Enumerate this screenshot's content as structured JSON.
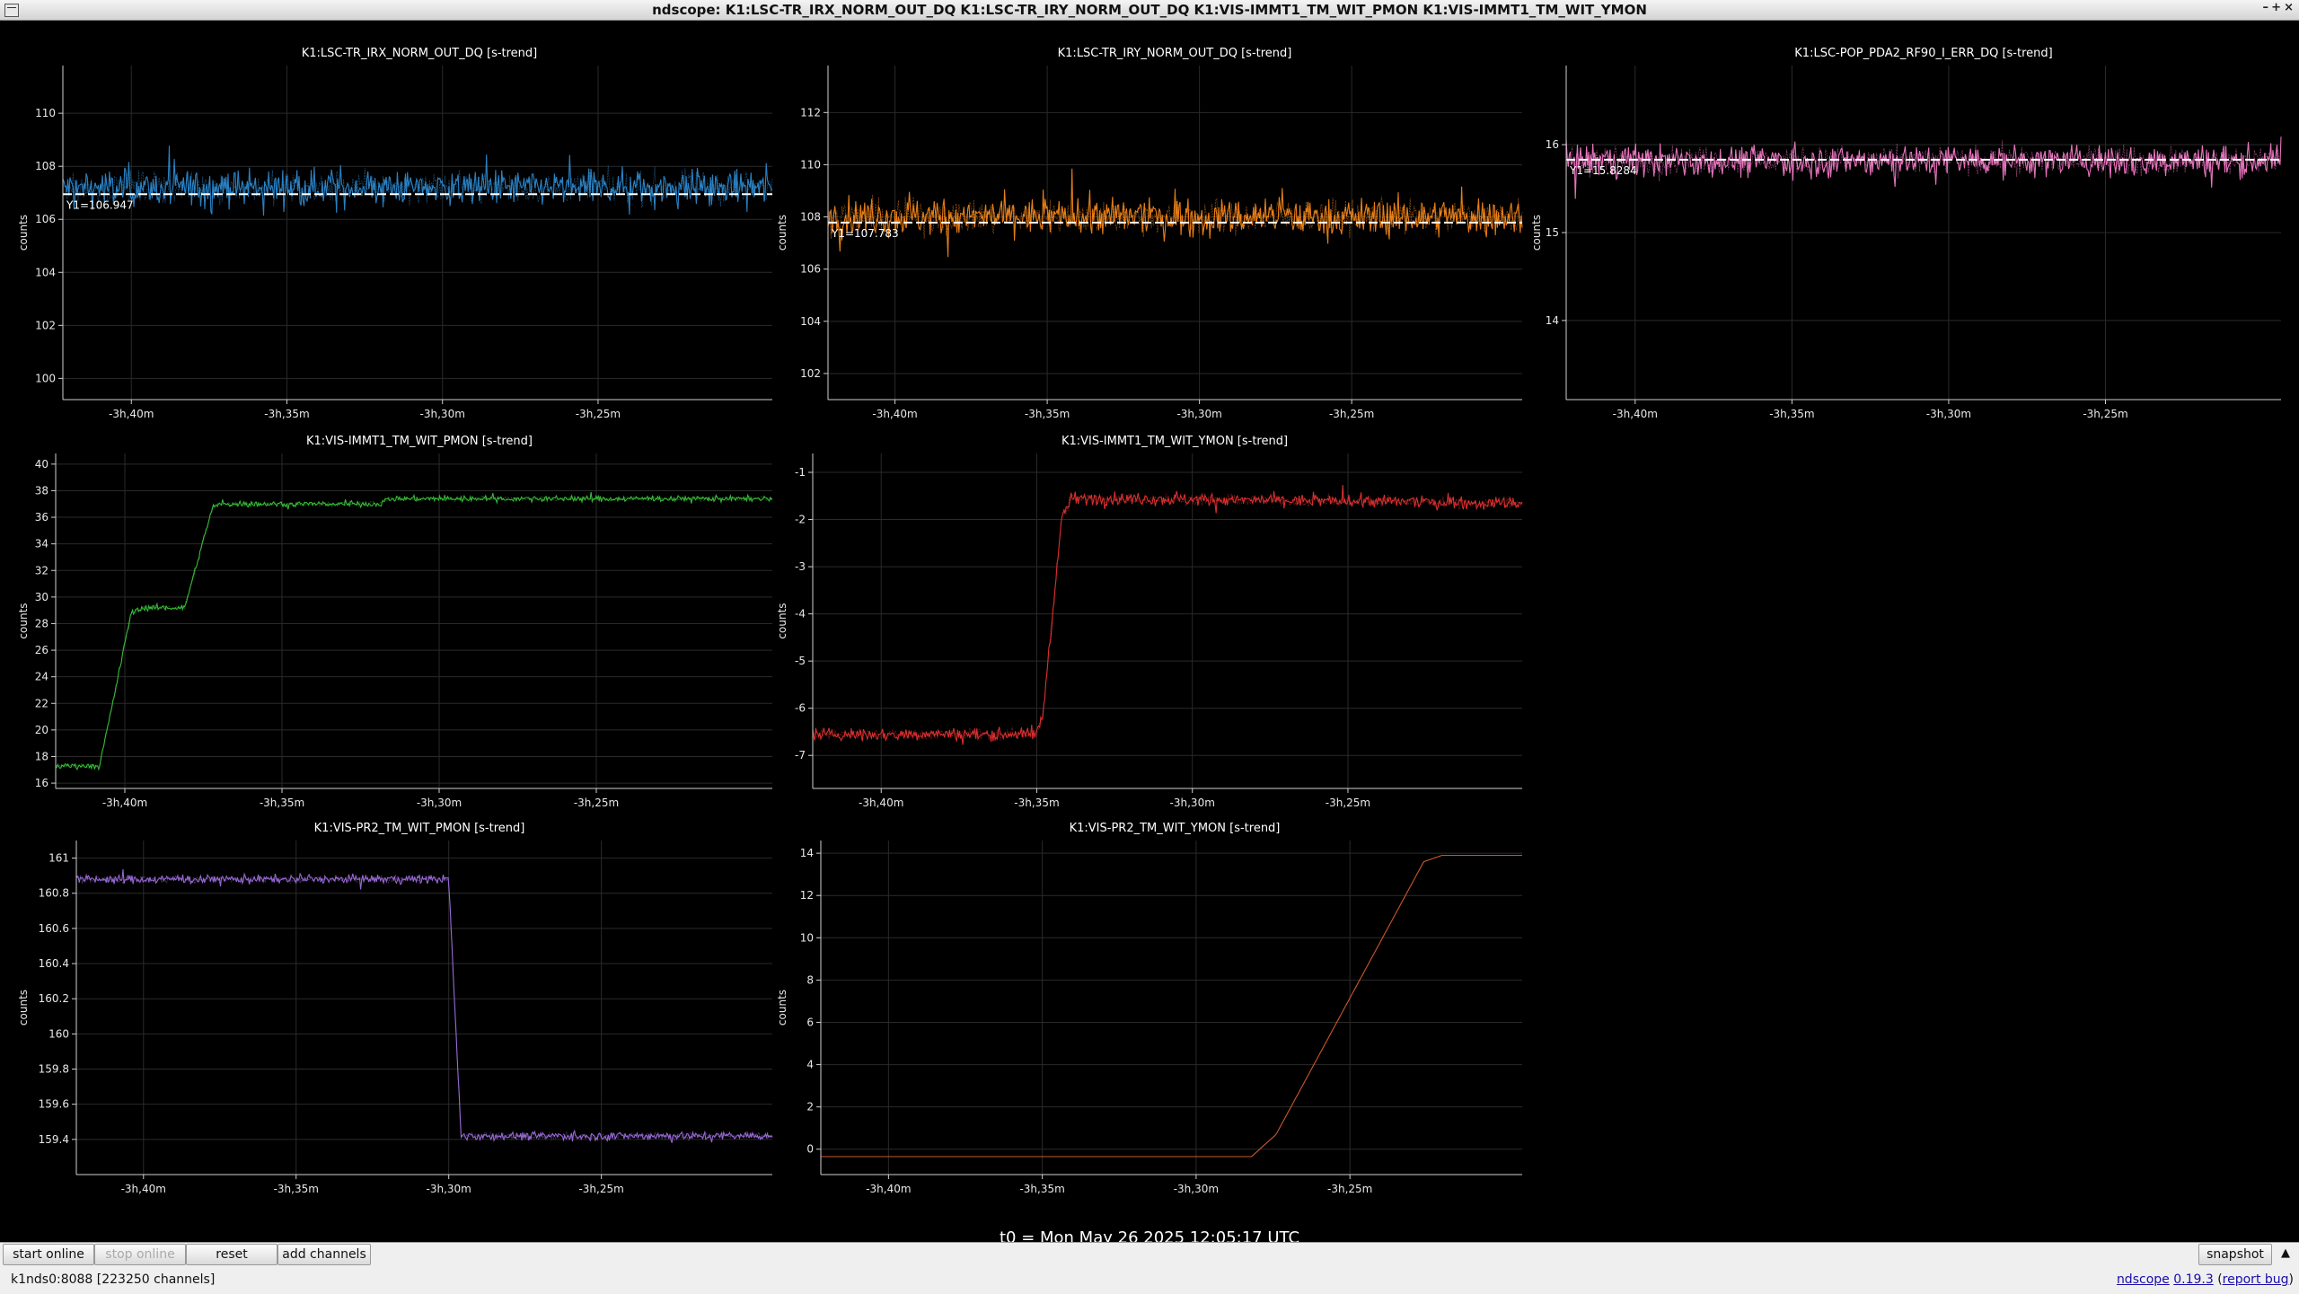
{
  "window": {
    "title": "ndscope: K1:LSC-TR_IRX_NORM_OUT_DQ K1:LSC-TR_IRY_NORM_OUT_DQ K1:VIS-IMMT1_TM_WIT_PMON K1:VIS-IMMT1_TM_WIT_YMON",
    "controls": [
      "–",
      "+",
      "×"
    ]
  },
  "axis_label": "counts",
  "x_ticks": [
    "-3h,40m",
    "-3h,35m",
    "-3h,30m",
    "-3h,25m"
  ],
  "colors": {
    "background": "#000000",
    "grid": "#2a2a2a",
    "axis": "#cfcfcf",
    "cursor": "#ffffff"
  },
  "chart_data": [
    {
      "type": "line",
      "title": "K1:LSC-TR_IRX_NORM_OUT_DQ [s-trend]",
      "ylabel": "counts",
      "xlim": [
        -42.2,
        -19.4
      ],
      "ylim": [
        99.2,
        111.8
      ],
      "yticks": [
        100,
        102,
        104,
        106,
        108,
        110
      ],
      "x_ticks": [
        -40,
        -35,
        -30,
        -25
      ],
      "x_tick_labels": [
        "-3h,40m",
        "-3h,35m",
        "-3h,30m",
        "-3h,25m"
      ],
      "series": [
        {
          "color": "#2f8fd8",
          "mean": 107.2,
          "noise": 1.1,
          "shape": "flat"
        }
      ],
      "cursor": {
        "y": 106.947,
        "label": "Y1=106.947"
      }
    },
    {
      "type": "line",
      "title": "K1:LSC-TR_IRY_NORM_OUT_DQ [s-trend]",
      "ylabel": "counts",
      "xlim": [
        -42.2,
        -19.4
      ],
      "ylim": [
        101.0,
        113.8
      ],
      "yticks": [
        102,
        104,
        106,
        108,
        110,
        112
      ],
      "x_ticks": [
        -40,
        -35,
        -30,
        -25
      ],
      "x_tick_labels": [
        "-3h,40m",
        "-3h,35m",
        "-3h,30m",
        "-3h,25m"
      ],
      "series": [
        {
          "color": "#ff8c1a",
          "mean": 108.0,
          "noise": 1.2,
          "shape": "flat"
        }
      ],
      "cursor": {
        "y": 107.783,
        "label": "Y1=107.783"
      }
    },
    {
      "type": "line",
      "title": "K1:LSC-POP_PDA2_RF90_I_ERR_DQ [s-trend]",
      "ylabel": "counts",
      "xlim": [
        -42.2,
        -19.4
      ],
      "ylim": [
        13.1,
        16.9
      ],
      "yticks": [
        14,
        15,
        16
      ],
      "x_ticks": [
        -40,
        -35,
        -30,
        -25
      ],
      "x_tick_labels": [
        "-3h,40m",
        "-3h,35m",
        "-3h,30m",
        "-3h,25m"
      ],
      "series": [
        {
          "color": "#ff7fd0",
          "mean": 15.82,
          "noise": 0.3,
          "shape": "flat"
        }
      ],
      "cursor": {
        "y": 15.8284,
        "label": "Y1=15.8284"
      }
    },
    {
      "type": "line",
      "title": "K1:VIS-IMMT1_TM_WIT_PMON [s-trend]",
      "ylabel": "counts",
      "xlim": [
        -42.2,
        -19.4
      ],
      "ylim": [
        15.6,
        40.8
      ],
      "yticks": [
        16,
        18,
        20,
        22,
        24,
        26,
        28,
        30,
        32,
        34,
        36,
        38,
        40
      ],
      "x_ticks": [
        -40,
        -35,
        -30,
        -25
      ],
      "x_tick_labels": [
        "-3h,40m",
        "-3h,35m",
        "-3h,30m",
        "-3h,25m"
      ],
      "series": [
        {
          "color": "#3ccc3c",
          "noise": 0.35,
          "shape": "points",
          "points": [
            [
              -42.2,
              17.3
            ],
            [
              -40.8,
              17.3
            ],
            [
              -39.8,
              28.8
            ],
            [
              -39.4,
              29.2
            ],
            [
              -38.1,
              29.2
            ],
            [
              -37.2,
              36.8
            ],
            [
              -36.9,
              37.0
            ],
            [
              -31.9,
              37.0
            ],
            [
              -31.6,
              37.4
            ],
            [
              -19.4,
              37.4
            ]
          ]
        }
      ]
    },
    {
      "type": "line",
      "title": "K1:VIS-IMMT1_TM_WIT_YMON [s-trend]",
      "ylabel": "counts",
      "xlim": [
        -42.2,
        -19.4
      ],
      "ylim": [
        -7.7,
        -0.6
      ],
      "yticks": [
        -1,
        -2,
        -3,
        -4,
        -5,
        -6,
        -7
      ],
      "x_ticks": [
        -40,
        -35,
        -30,
        -25
      ],
      "x_tick_labels": [
        "-3h,40m",
        "-3h,35m",
        "-3h,30m",
        "-3h,25m"
      ],
      "series": [
        {
          "color": "#ee3333",
          "noise": 0.22,
          "shape": "points",
          "points": [
            [
              -42.2,
              -6.55
            ],
            [
              -35.0,
              -6.55
            ],
            [
              -34.8,
              -6.1
            ],
            [
              -34.2,
              -2.0
            ],
            [
              -33.9,
              -1.55
            ],
            [
              -19.4,
              -1.65
            ]
          ]
        }
      ]
    },
    {
      "type": "line",
      "title": "K1:VIS-PR2_TM_WIT_PMON [s-trend]",
      "ylabel": "counts",
      "xlim": [
        -42.2,
        -19.4
      ],
      "ylim": [
        159.2,
        161.1
      ],
      "yticks": [
        159.4,
        159.6,
        159.8,
        160,
        160.2,
        160.4,
        160.6,
        160.8,
        161
      ],
      "x_ticks": [
        -40,
        -35,
        -30,
        -25
      ],
      "x_tick_labels": [
        "-3h,40m",
        "-3h,35m",
        "-3h,30m",
        "-3h,25m"
      ],
      "series": [
        {
          "color": "#a472e8",
          "noise": 0.04,
          "shape": "points",
          "points": [
            [
              -42.2,
              160.88
            ],
            [
              -30.0,
              160.88
            ],
            [
              -29.6,
              159.42
            ],
            [
              -19.4,
              159.42
            ]
          ]
        }
      ]
    },
    {
      "type": "line",
      "title": "K1:VIS-PR2_TM_WIT_YMON [s-trend]",
      "ylabel": "counts",
      "xlim": [
        -42.2,
        -19.4
      ],
      "ylim": [
        -1.2,
        14.6
      ],
      "yticks": [
        0,
        2,
        4,
        6,
        8,
        10,
        12,
        14
      ],
      "x_ticks": [
        -40,
        -35,
        -30,
        -25
      ],
      "x_tick_labels": [
        "-3h,40m",
        "-3h,35m",
        "-3h,30m",
        "-3h,25m"
      ],
      "series": [
        {
          "color": "#e06030",
          "noise": 0.0,
          "shape": "points",
          "points": [
            [
              -42.2,
              -0.35
            ],
            [
              -28.2,
              -0.35
            ],
            [
              -27.4,
              0.7
            ],
            [
              -22.6,
              13.6
            ],
            [
              -22.0,
              13.9
            ],
            [
              -19.4,
              13.9
            ]
          ]
        }
      ]
    }
  ],
  "t0": "t0 = Mon May 26 2025 12:05:17 UTC [1432296335.0625]",
  "buttons": {
    "start_online": "start online",
    "stop_online": "stop online",
    "reset": "reset",
    "add_channels": "add channels",
    "snapshot": "snapshot",
    "expand": "▲"
  },
  "status": "k1nds0:8088  [223250 channels]",
  "version": {
    "app": "ndscope",
    "number": "0.19.3",
    "open_paren": "(",
    "report": "report bug",
    "close_paren": ")"
  }
}
